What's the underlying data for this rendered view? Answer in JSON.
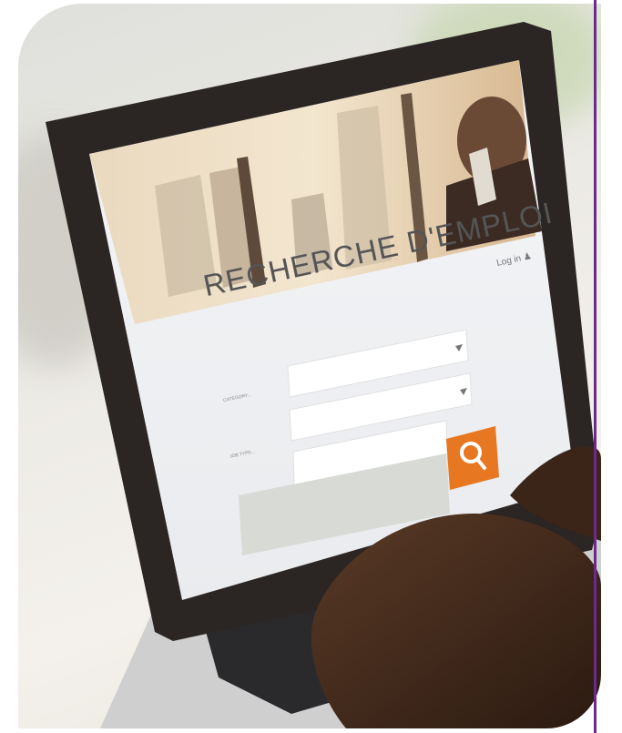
{
  "screen": {
    "title": "RECHERCHE D'EMPLOI",
    "login_label": "Log in",
    "category_label": "CATEGORY...",
    "jobtype_label": "JOB TYPE..."
  },
  "colors": {
    "accent_line": "#6c2a8a",
    "search_button": "#e87722"
  },
  "icons": {
    "search": "search-icon",
    "user": "user-icon",
    "dropdown": "chevron-down-icon"
  }
}
